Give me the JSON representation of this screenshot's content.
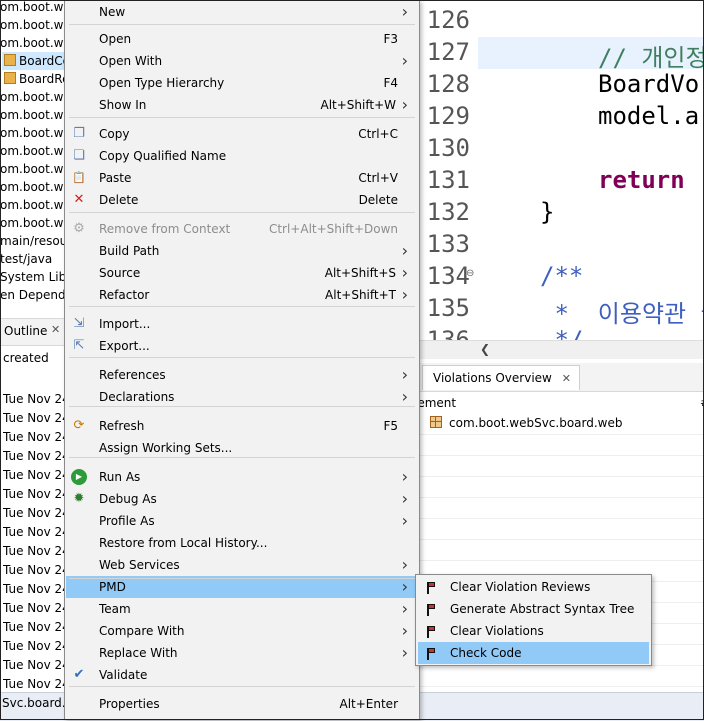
{
  "explorer": {
    "items": [
      "om.boot.w",
      "om.boot.w",
      "om.boot.w",
      "BoardCor",
      "BoardRes",
      "om.boot.w",
      "om.boot.w",
      "om.boot.w",
      "om.boot.w",
      "om.boot.w",
      "om.boot.w",
      "om.boot.w",
      "om.boot.w",
      "main/resou",
      "test/java",
      "System Lib",
      "en Depend"
    ]
  },
  "outline": {
    "tab_label": "Outline",
    "header": "created",
    "rows": [
      "Tue Nov 24",
      "Tue Nov 24",
      "Tue Nov 24",
      "Tue Nov 24",
      "Tue Nov 24",
      "Tue Nov 24",
      "Tue Nov 24",
      "Tue Nov 24",
      "Tue Nov 24",
      "Tue Nov 24",
      "Tue Nov 24",
      "Tue Nov 24",
      "Tue Nov 24",
      "Tue Nov 24",
      "Tue Nov 24",
      "Tue Nov 24",
      "Tue Nov 24"
    ]
  },
  "editor": {
    "line_numbers": [
      "126",
      "127",
      "128",
      "129",
      "130",
      "131",
      "132",
      "133",
      "134",
      "135",
      "136"
    ],
    "lines": [
      "",
      "// 개인정",
      "BoardVo",
      "model.a",
      "",
      "return",
      "}",
      "",
      "/**",
      " *  이용약관 글",
      " */"
    ]
  },
  "violations": {
    "tab_label": "Violations Overview",
    "column_header": "lement",
    "row": "com.boot.webSvc.board.web"
  },
  "status": {
    "text": "Svc.board.w"
  },
  "menu": {
    "items": [
      {
        "label": "New",
        "shortcut": "",
        "arrow": true
      },
      {
        "label": "Open",
        "shortcut": "F3"
      },
      {
        "label": "Open With",
        "shortcut": "",
        "arrow": true
      },
      {
        "label": "Open Type Hierarchy",
        "shortcut": "F4"
      },
      {
        "label": "Show In",
        "shortcut": "Alt+Shift+W",
        "arrow": true
      },
      {
        "label": "Copy",
        "shortcut": "Ctrl+C",
        "icon": "copy-icon"
      },
      {
        "label": "Copy Qualified Name",
        "shortcut": "",
        "icon": "copy-qualified-icon"
      },
      {
        "label": "Paste",
        "shortcut": "Ctrl+V",
        "icon": "paste-icon"
      },
      {
        "label": "Delete",
        "shortcut": "Delete",
        "icon": "delete-icon"
      },
      {
        "label": "Remove from Context",
        "shortcut": "Ctrl+Alt+Shift+Down",
        "icon": "remove-context-icon",
        "disabled": true
      },
      {
        "label": "Build Path",
        "shortcut": "",
        "arrow": true
      },
      {
        "label": "Source",
        "shortcut": "Alt+Shift+S",
        "arrow": true
      },
      {
        "label": "Refactor",
        "shortcut": "Alt+Shift+T",
        "arrow": true
      },
      {
        "label": "Import...",
        "shortcut": "",
        "icon": "import-icon"
      },
      {
        "label": "Export...",
        "shortcut": "",
        "icon": "export-icon"
      },
      {
        "label": "References",
        "shortcut": "",
        "arrow": true
      },
      {
        "label": "Declarations",
        "shortcut": "",
        "arrow": true
      },
      {
        "label": "Refresh",
        "shortcut": "F5",
        "icon": "refresh-icon"
      },
      {
        "label": "Assign Working Sets...",
        "shortcut": ""
      },
      {
        "label": "Run As",
        "shortcut": "",
        "arrow": true,
        "icon": "run-icon"
      },
      {
        "label": "Debug As",
        "shortcut": "",
        "arrow": true,
        "icon": "debug-icon"
      },
      {
        "label": "Profile As",
        "shortcut": "",
        "arrow": true
      },
      {
        "label": "Restore from Local History...",
        "shortcut": ""
      },
      {
        "label": "Web Services",
        "shortcut": "",
        "arrow": true
      },
      {
        "label": "PMD",
        "shortcut": "",
        "arrow": true
      },
      {
        "label": "Team",
        "shortcut": "",
        "arrow": true
      },
      {
        "label": "Compare With",
        "shortcut": "",
        "arrow": true
      },
      {
        "label": "Replace With",
        "shortcut": "",
        "arrow": true
      },
      {
        "label": "Validate",
        "shortcut": "",
        "icon": "check-icon"
      },
      {
        "label": "Properties",
        "shortcut": "Alt+Enter"
      }
    ]
  },
  "submenu": {
    "items": [
      "Clear Violation Reviews",
      "Generate Abstract Syntax Tree",
      "Clear Violations",
      "Check Code"
    ]
  },
  "colors": {
    "highlight": "#91c9f7",
    "menu_bg": "#f2f2f2",
    "keyword": "#7f0055",
    "comment": "#3f5fbf"
  }
}
